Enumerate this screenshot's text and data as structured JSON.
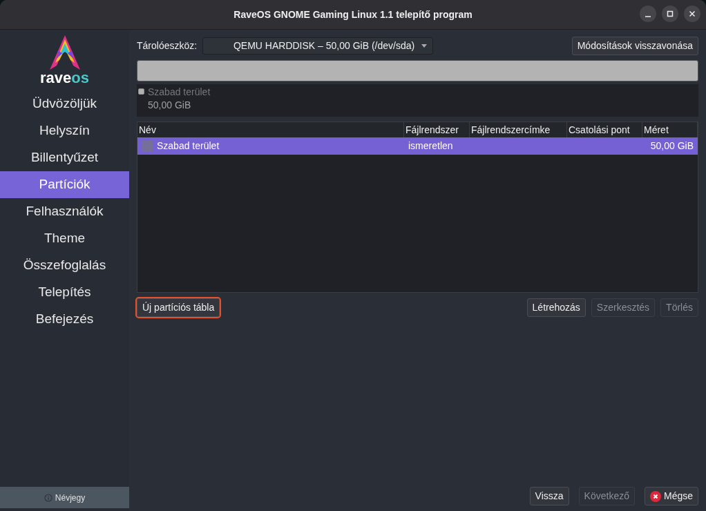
{
  "window": {
    "title": "RaveOS GNOME Gaming Linux 1.1 telepítő program"
  },
  "logo": {
    "text_main": "rave",
    "text_accent": "os"
  },
  "sidebar": {
    "items": [
      {
        "label": "Üdvözöljük",
        "selected": false
      },
      {
        "label": "Helyszín",
        "selected": false
      },
      {
        "label": "Billentyűzet",
        "selected": false
      },
      {
        "label": "Partíciók",
        "selected": true
      },
      {
        "label": "Felhasználók",
        "selected": false
      },
      {
        "label": "Theme",
        "selected": false
      },
      {
        "label": "Összefoglalás",
        "selected": false
      },
      {
        "label": "Telepítés",
        "selected": false
      },
      {
        "label": "Befejezés",
        "selected": false
      }
    ],
    "about_button": "Névjegy"
  },
  "device": {
    "label": "Tárolóeszköz:",
    "value": "QEMU HARDDISK – 50,00 GiB (/dev/sda)"
  },
  "revert_button": "Módosítások visszavonása",
  "legend": [
    {
      "name": "Szabad terület",
      "size": "50,00 GiB",
      "color": "#b0b0b0"
    }
  ],
  "table": {
    "columns": [
      "Név",
      "Fájlrendszer",
      "Fájlrendszercímke",
      "Csatolási pont",
      "Méret"
    ],
    "rows": [
      {
        "cells": [
          "Szabad terület",
          "ismeretlen",
          "",
          "",
          "50,00 GiB"
        ],
        "selected": true
      }
    ]
  },
  "partition_buttons": [
    {
      "label": "Új partíciós tábla",
      "disabled": false,
      "focused": true
    },
    {
      "label": "Létrehozás",
      "disabled": false,
      "focused": false
    },
    {
      "label": "Szerkesztés",
      "disabled": true,
      "focused": false
    },
    {
      "label": "Törlés",
      "disabled": true,
      "focused": false
    }
  ],
  "nav_buttons": [
    {
      "label": "Vissza",
      "disabled": false,
      "kind": "plain"
    },
    {
      "label": "Következő",
      "disabled": true,
      "kind": "plain"
    },
    {
      "label": "Mégse",
      "disabled": false,
      "kind": "cancel"
    }
  ]
}
